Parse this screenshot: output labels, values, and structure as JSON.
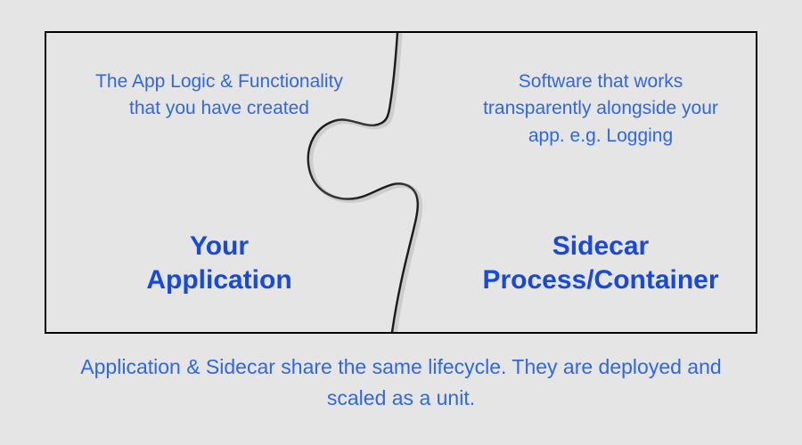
{
  "left": {
    "description": "The App Logic & Functionality that you have created",
    "title_line1": "Your",
    "title_line2": "Application"
  },
  "right": {
    "description": "Software that works transparently alongside your app. e.g. Logging",
    "title_line1": "Sidecar",
    "title_line2": "Process/Container"
  },
  "caption": "Application & Sidecar share the same lifecycle. They are deployed and scaled as a unit."
}
